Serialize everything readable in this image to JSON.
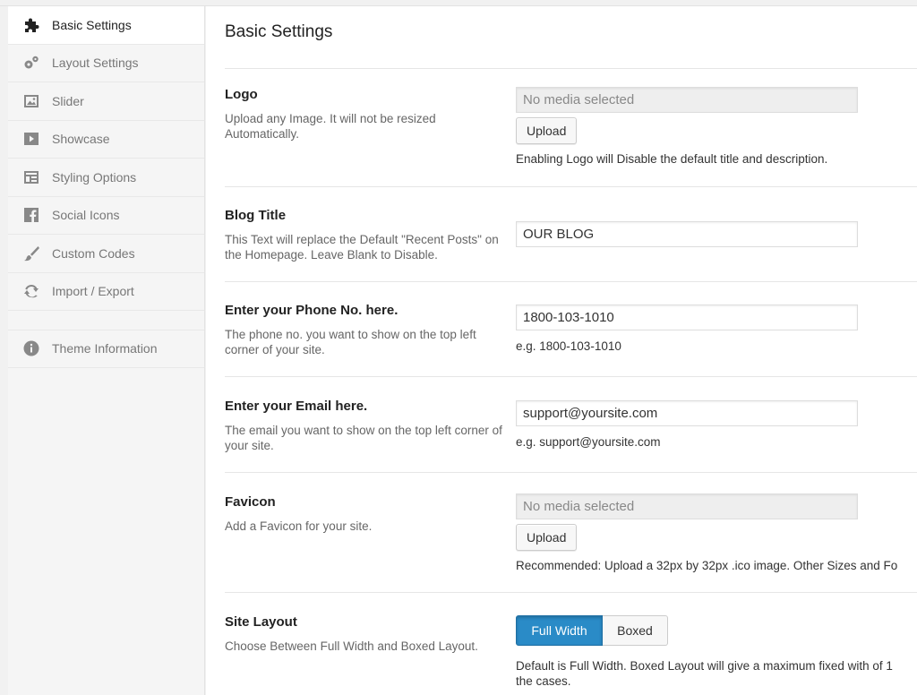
{
  "sidebar": {
    "items": [
      {
        "label": "Basic Settings",
        "icon": "puzzle-icon"
      },
      {
        "label": "Layout Settings",
        "icon": "gears-icon"
      },
      {
        "label": "Slider",
        "icon": "image-icon"
      },
      {
        "label": "Showcase",
        "icon": "play-icon"
      },
      {
        "label": "Styling Options",
        "icon": "layout-icon"
      },
      {
        "label": "Social Icons",
        "icon": "facebook-icon"
      },
      {
        "label": "Custom Codes",
        "icon": "brush-icon"
      },
      {
        "label": "Import / Export",
        "icon": "refresh-icon"
      },
      {
        "label": "Theme Information",
        "icon": "info-icon"
      }
    ]
  },
  "main": {
    "title": "Basic Settings",
    "logo": {
      "title": "Logo",
      "desc": "Upload any Image. It will not be resized Automatically.",
      "placeholder": "No media selected",
      "upload": "Upload",
      "hint": "Enabling Logo will Disable the default title and description."
    },
    "blog_title": {
      "title": "Blog Title",
      "desc": "This Text will replace the Default \"Recent Posts\" on the Homepage. Leave Blank to Disable.",
      "value": "OUR BLOG"
    },
    "phone": {
      "title": "Enter your Phone No. here.",
      "desc": "The phone no. you want to show on the top left corner of your site.",
      "value": "1800-103-1010",
      "hint": "e.g. 1800-103-1010"
    },
    "email": {
      "title": "Enter your Email here.",
      "desc": "The email you want to show on the top left corner of your site.",
      "value": "support@yoursite.com",
      "hint": "e.g. support@yoursite.com"
    },
    "favicon": {
      "title": "Favicon",
      "desc": "Add a Favicon for your site.",
      "placeholder": "No media selected",
      "upload": "Upload",
      "hint": "Recommended: Upload a 32px by 32px .ico image. Other Sizes and Fo"
    },
    "site_layout": {
      "title": "Site Layout",
      "desc": "Choose Between Full Width and Boxed Layout.",
      "option_full": "Full Width",
      "option_boxed": "Boxed",
      "hint_line1": "Default is Full Width. Boxed Layout will give a maximum fixed with of 1",
      "hint_line2": "the cases."
    }
  },
  "colors": {
    "accent": "#2a8bc7",
    "active_bg": "#ffffff"
  }
}
